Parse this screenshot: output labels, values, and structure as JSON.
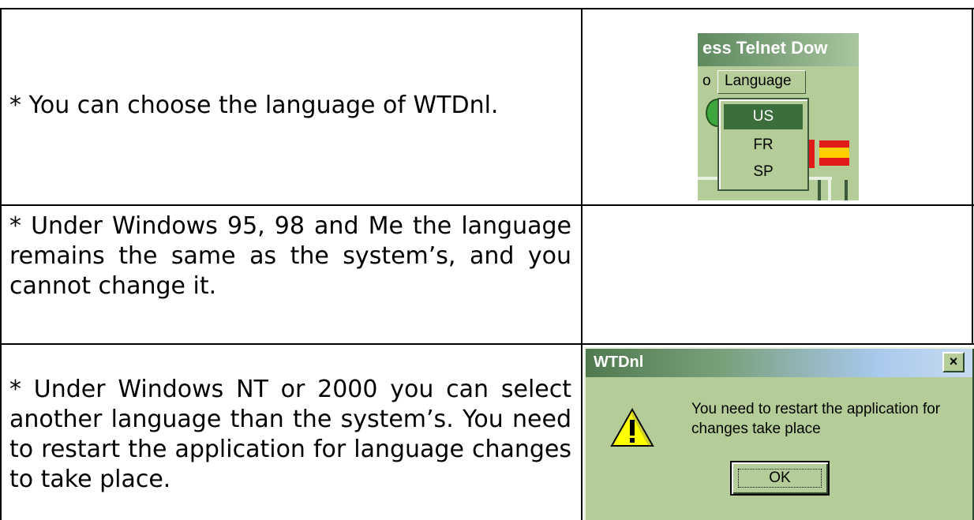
{
  "rows": [
    {
      "text": "* You can choose the language of WTDnl."
    },
    {
      "text": "* Under Windows 95, 98 and Me the language remains the same as the system’s, and you cannot change it."
    },
    {
      "text": "* Under Windows NT or 2000 you can select another language than the system’s. You need to restart the application for language changes to take place."
    }
  ],
  "menu_screenshot": {
    "title_fragment": "ess Telnet Dow",
    "menubar_left_fragment": "o",
    "menu_label": "Language",
    "items": [
      "US",
      "FR",
      "SP"
    ],
    "selected_item": "US",
    "colors": {
      "background": "#b4cc98",
      "selection": "#3c6e3c"
    }
  },
  "dialog": {
    "title": "WTDnl",
    "close_glyph": "×",
    "message": "You need to restart the application for changes take place",
    "ok_label": "OK",
    "icon": "warning-icon"
  }
}
